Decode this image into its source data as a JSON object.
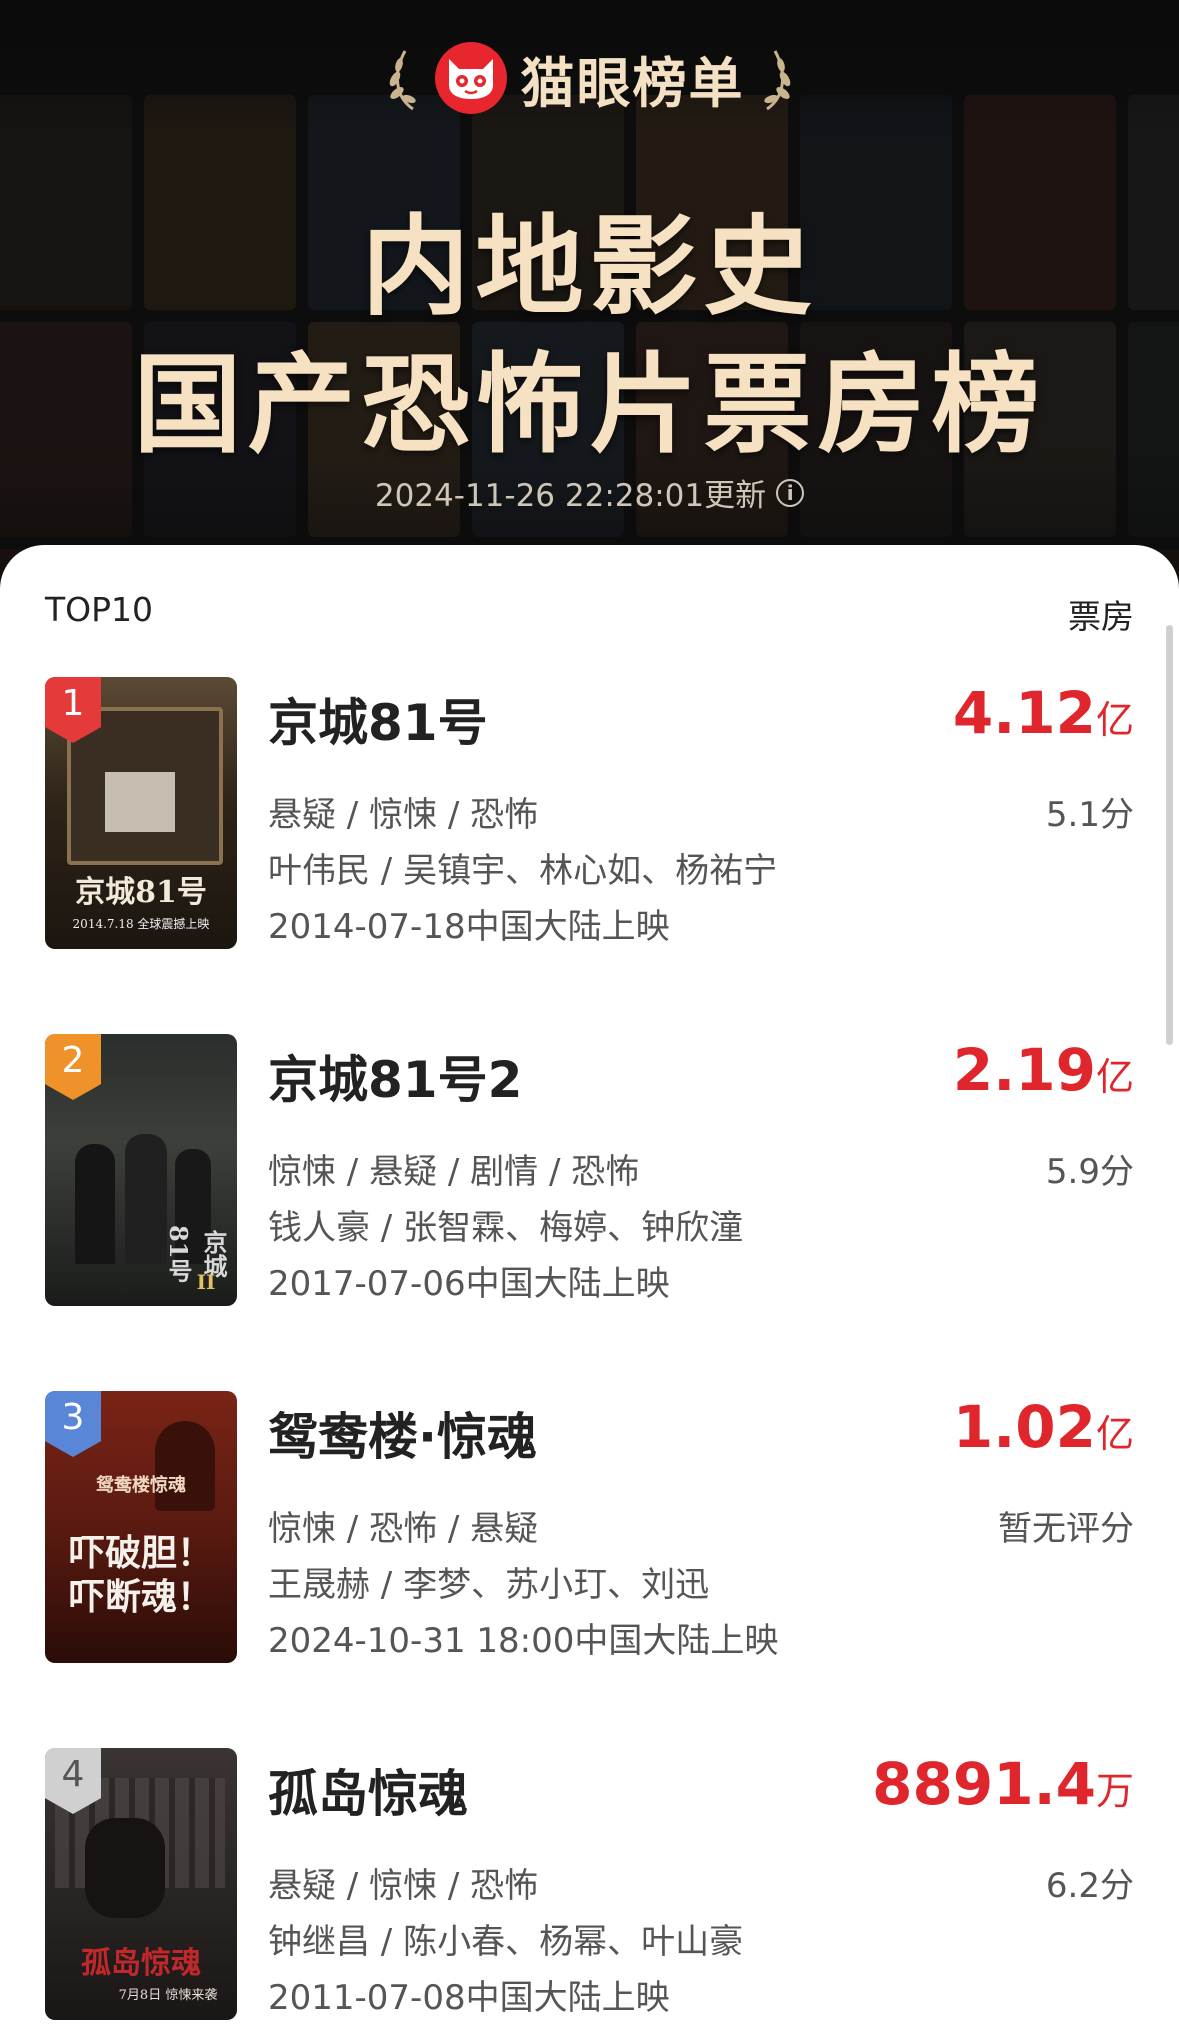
{
  "brand": {
    "name": "猫眼榜单",
    "logo_icon": "cat-face-icon",
    "accent": "#e8262d"
  },
  "title": {
    "line1": "内地影史",
    "line2": "国产恐怖片票房榜"
  },
  "update_time": "2024-11-26 22:28:01更新",
  "list": {
    "header_left": "TOP10",
    "header_right": "票房"
  },
  "movies": [
    {
      "rank": "1",
      "name": "京城81号",
      "box_num": "4.12",
      "box_unit": "亿",
      "genres": "悬疑 / 惊悚 / 恐怖",
      "score": "5.1分",
      "cast": "叶伟民 / 吴镇宇、林心如、杨祐宁",
      "release": "2014-07-18中国大陆上映",
      "poster_text": "京城81号",
      "poster_sub": "2014.7.18 全球震撼上映"
    },
    {
      "rank": "2",
      "name": "京城81号2",
      "box_num": "2.19",
      "box_unit": "亿",
      "genres": "惊悚 / 悬疑 / 剧情 / 恐怖",
      "score": "5.9分",
      "cast": "钱人豪 / 张智霖、梅婷、钟欣潼",
      "release": "2017-07-06中国大陆上映",
      "poster_text": "京城81号",
      "poster_sub": "II"
    },
    {
      "rank": "3",
      "name": "鸳鸯楼·惊魂",
      "box_num": "1.02",
      "box_unit": "亿",
      "genres": "惊悚 / 恐怖 / 悬疑",
      "score": "暂无评分",
      "cast": "王晟赫 / 李梦、苏小玎、刘迅",
      "release": "2024-10-31 18:00中国大陆上映",
      "poster_text": "吓破胆！吓断魂！",
      "poster_sub": "鸳鸯楼惊魂"
    },
    {
      "rank": "4",
      "name": "孤岛惊魂",
      "box_num": "8891.4",
      "box_unit": "万",
      "genres": "悬疑 / 惊悚 / 恐怖",
      "score": "6.2分",
      "cast": "钟继昌 / 陈小春、杨幂、叶山豪",
      "release": "2011-07-08中国大陆上映",
      "poster_text": "孤岛惊魂",
      "poster_sub": "7月8日 惊悚来袭"
    }
  ]
}
